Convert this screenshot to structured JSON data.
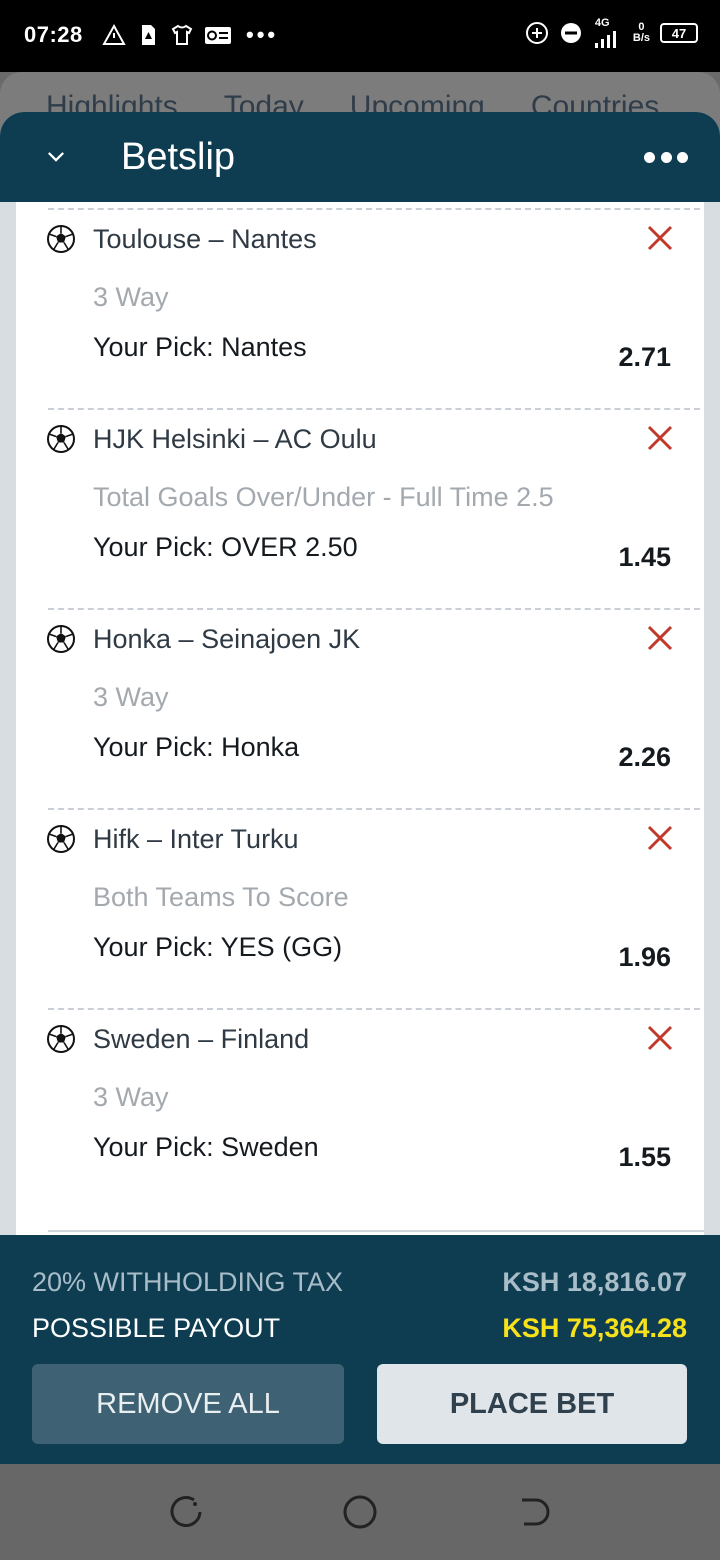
{
  "status_bar": {
    "time": "07:28",
    "network": "4G",
    "speed_value": "0",
    "speed_unit": "B/s",
    "battery": "47",
    "icons": [
      "warning-triangle-icon",
      "sim-alert-icon",
      "tshirt-icon",
      "mail-card-icon",
      "more-dots-icon",
      "add-circle-icon",
      "do-not-disturb-icon",
      "signal-icon"
    ]
  },
  "background_app": {
    "tabs": [
      "Highlights",
      "Today",
      "Upcoming",
      "Countries"
    ]
  },
  "betslip": {
    "title": "Betslip",
    "bets": [
      {
        "match": "Toulouse – Nantes",
        "market": "3 Way",
        "pick": "Your Pick: Nantes",
        "odds": "2.71"
      },
      {
        "match": "HJK Helsinki – AC Oulu",
        "market": "Total Goals Over/Under - Full Time 2.5",
        "pick": "Your Pick: OVER 2.50",
        "odds": "1.45"
      },
      {
        "match": "Honka – Seinajoen JK",
        "market": "3 Way",
        "pick": "Your Pick: Honka",
        "odds": "2.26"
      },
      {
        "match": "Hifk – Inter Turku",
        "market": "Both Teams To Score",
        "pick": "Your Pick: YES (GG)",
        "odds": "1.96"
      },
      {
        "match": "Sweden – Finland",
        "market": "3 Way",
        "pick": "Your Pick: Sweden",
        "odds": "1.55"
      }
    ],
    "summary": {
      "tax_label": "20% WITHHOLDING TAX",
      "tax_value": "KSH 18,816.07",
      "payout_label": "POSSIBLE PAYOUT",
      "payout_value": "KSH 75,364.28"
    },
    "buttons": {
      "remove_all": "REMOVE ALL",
      "place_bet": "PLACE BET"
    }
  },
  "colors": {
    "header": "#0e3d52",
    "remove_icon": "#c0392b",
    "payout": "#f6e11b"
  }
}
